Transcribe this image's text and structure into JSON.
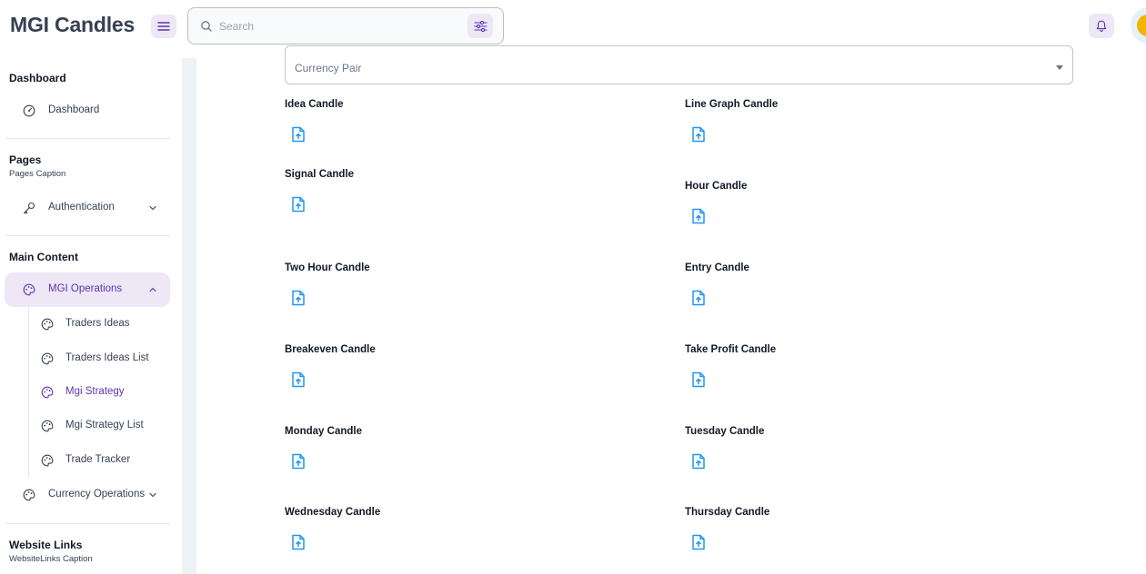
{
  "header": {
    "app_title": "MGI Candles",
    "search": {
      "placeholder": "Search",
      "value": ""
    },
    "icons": {
      "menu": "menu-icon",
      "search": "search-icon",
      "filter": "filter-icon",
      "bell": "bell-icon"
    }
  },
  "sidebar": {
    "groups": {
      "dashboard": {
        "title": "Dashboard",
        "items": {
          "dashboard": "Dashboard"
        }
      },
      "pages": {
        "title": "Pages",
        "caption": "Pages Caption",
        "items": {
          "authentication": "Authentication"
        }
      },
      "main_content": {
        "title": "Main Content",
        "items": {
          "mgi_operations": "MGI Operations",
          "traders_ideas": "Traders Ideas",
          "traders_ideas_list": "Traders Ideas List",
          "mgi_strategy": "Mgi Strategy",
          "mgi_strategy_list": "Mgi Strategy List",
          "trade_tracker": "Trade Tracker",
          "currency_operations": "Currency Operations"
        }
      },
      "website_links": {
        "title": "Website Links",
        "caption": "WebsiteLinks Caption"
      }
    }
  },
  "form": {
    "currency_pair": {
      "label": "Currency Pair",
      "value": ""
    },
    "fields": {
      "idea": "Idea Candle",
      "line_graph": "Line Graph Candle",
      "signal": "Signal Candle",
      "hour": "Hour Candle",
      "two_hour": "Two Hour Candle",
      "entry": "Entry Candle",
      "breakeven": "Breakeven Candle",
      "take_profit": "Take Profit Candle",
      "monday": "Monday Candle",
      "tuesday": "Tuesday Candle",
      "wednesday": "Wednesday Candle",
      "thursday": "Thursday Candle"
    }
  },
  "colors": {
    "accent": "#5e35b1",
    "accent_light": "#ede7f6",
    "upload_icon": "#2196f3",
    "background": "#eef2f6"
  }
}
